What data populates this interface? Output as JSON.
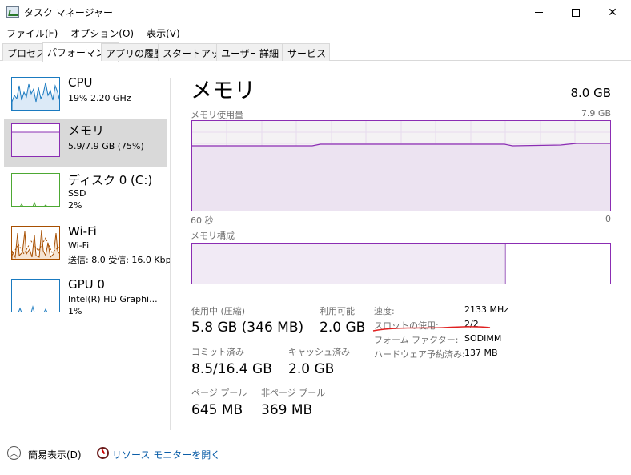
{
  "window": {
    "title": "タスク マネージャー"
  },
  "menu": [
    "ファイル(F)",
    "オプション(O)",
    "表示(V)"
  ],
  "tabs": [
    "プロセス",
    "パフォーマンス",
    "アプリの履歴",
    "スタートアップ",
    "ユーザー",
    "詳細",
    "サービス"
  ],
  "active_tab": "パフォーマンス",
  "sidebar": [
    {
      "title": "CPU",
      "lines": [
        "19%  2.20 GHz"
      ],
      "color": "#1a7ac0"
    },
    {
      "title": "メモリ",
      "lines": [
        "5.9/7.9 GB (75%)"
      ],
      "color": "#8b2db3",
      "selected": true
    },
    {
      "title": "ディスク 0 (C:)",
      "lines": [
        "SSD",
        "2%"
      ],
      "color": "#4da833"
    },
    {
      "title": "Wi-Fi",
      "lines": [
        "Wi-Fi",
        "送信: 8.0  受信: 16.0 Kbp"
      ],
      "color": "#a74f01"
    },
    {
      "title": "GPU 0",
      "lines": [
        "Intel(R) HD Graphi...",
        "1%"
      ],
      "color": "#1a7ac0"
    }
  ],
  "main": {
    "title": "メモリ",
    "total": "8.0 GB",
    "usage_label": "メモリ使用量",
    "usage_max": "7.9 GB",
    "time_left": "60 秒",
    "time_right": "0",
    "composition_label": "メモリ構成",
    "usage_fraction": 0.75,
    "stats": {
      "in_use_label": "使用中 (圧縮)",
      "in_use_value": "5.8 GB (346 MB)",
      "available_label": "利用可能",
      "available_value": "2.0 GB",
      "committed_label": "コミット済み",
      "committed_value": "8.5/16.4 GB",
      "cached_label": "キャッシュ済み",
      "cached_value": "2.0 GB",
      "paged_label": "ページ プール",
      "paged_value": "645 MB",
      "nonpaged_label": "非ページ プール",
      "nonpaged_value": "369 MB"
    },
    "details": {
      "speed_label": "速度:",
      "speed_value": "2133 MHz",
      "slots_label": "スロットの使用:",
      "slots_value": "2/2",
      "form_label": "フォーム ファクター:",
      "form_value": "SODIMM",
      "reserved_label": "ハードウェア予約済み:",
      "reserved_value": "137 MB"
    }
  },
  "footer": {
    "collapse_label": "簡易表示(D)",
    "monitor_link": "リソース モニターを開く"
  }
}
